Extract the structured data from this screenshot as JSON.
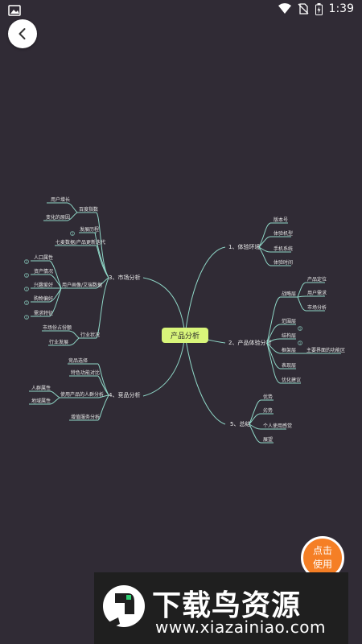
{
  "status_bar": {
    "time": "1:39"
  },
  "mindmap": {
    "root": "产品分析",
    "branches": {
      "market": {
        "label": "3、市场分析",
        "baidu": "百度指数",
        "user_growth": "用户增长",
        "change_reason": "变化的原因",
        "dev_history": "发展历程",
        "seven_data": "七麦数据/产品更新迭代",
        "portrait": "用户画像/艾瑞数据",
        "pop": "人口属性",
        "asset": "资产情况",
        "interest": "兴趣爱好",
        "shopping": "购物偏好",
        "demand": "需求特征",
        "industry_status": "行业状况",
        "share": "市场份占份额",
        "develop": "行业发展"
      },
      "compete": {
        "label": "4、竞品分析",
        "select": "竞品选择",
        "feature": "特色功能对比",
        "user_analysis": "使用产品的人群分析",
        "crowd": "人群属性",
        "region": "地域属性",
        "value_service": "增值服务分析"
      },
      "env": {
        "label": "1、体验环境",
        "version": "版本号",
        "model": "体验机型",
        "os": "手机系统",
        "time": "体验时间"
      },
      "experience": {
        "label": "2、产品体验分析",
        "strategy": "战略层",
        "positioning": "产品定位",
        "user_need": "用户需求",
        "market_need": "市场分析",
        "scope": "范围层",
        "structure": "结构层",
        "framework": "框架层",
        "main_ui": "主要界面的功能区",
        "surface": "表现层",
        "suggestion": "优化建议"
      },
      "summary": {
        "label": "5、总结",
        "advantage": "优势",
        "disadvantage": "劣势",
        "personal": "个人使用感觉",
        "outlook": "展望"
      }
    },
    "badge": "1"
  },
  "click_button": {
    "line1": "点击",
    "line2": "使用"
  },
  "watermark": {
    "title": "下载鸟资源",
    "url": "www.xiazainiao.com"
  },
  "colors": {
    "background": "#302b35",
    "root": "#d8f57a",
    "line": "#8fd7c7",
    "button": "#f57f25"
  }
}
